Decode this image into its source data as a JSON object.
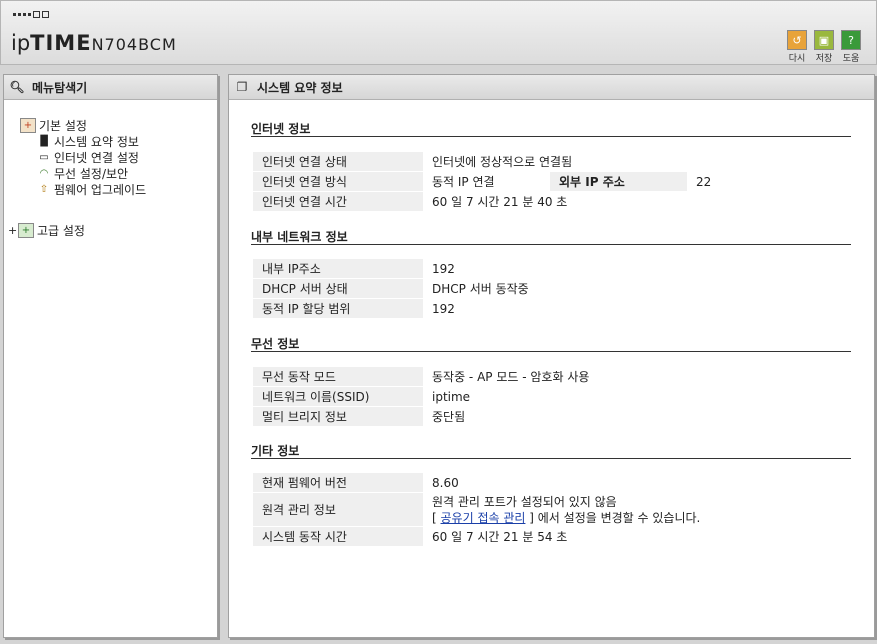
{
  "header": {
    "logo_ip": "ip",
    "logo_time": "TIME",
    "model": "N704BCM",
    "buttons": [
      {
        "label": "다시",
        "icon": "refresh-icon",
        "color": "#e8a33a"
      },
      {
        "label": "저장",
        "icon": "save-icon",
        "color": "#9ab83e"
      },
      {
        "label": "도움",
        "icon": "help-icon",
        "color": "#3a9a3a"
      }
    ]
  },
  "sidebar": {
    "title": "메뉴탐색기",
    "basic": "기본 설정",
    "items": [
      "시스템 요약 정보",
      "인터넷 연결 설정",
      "무선 설정/보안",
      "펌웨어 업그레이드"
    ],
    "advanced_expander": "+",
    "advanced": "고급 설정"
  },
  "main": {
    "title": "시스템 요약 정보",
    "internet": {
      "title": "인터넷 정보",
      "status_label": "인터넷 연결 상태",
      "status_value": "인터넷에 정상적으로 연결됨",
      "method_label": "인터넷 연결 방식",
      "method_value": "동적 IP 연결",
      "ext_ip_label": "외부 IP 주소",
      "ext_ip_value": "22",
      "time_label": "인터넷 연결 시간",
      "time_value": "60 일 7 시간 21 분 40 초"
    },
    "lan": {
      "title": "내부 네트워크 정보",
      "ip_label": "내부 IP주소",
      "ip_value": "192",
      "dhcp_label": "DHCP 서버 상태",
      "dhcp_value": "DHCP 서버 동작중",
      "range_label": "동적 IP 할당 범위",
      "range_value": "192"
    },
    "wireless": {
      "title": "무선 정보",
      "mode_label": "무선 동작 모드",
      "mode_value": "동작중 - AP 모드 - 암호화 사용",
      "ssid_label": "네트워크 이름(SSID)",
      "ssid_value": "iptime",
      "bridge_label": "멀티 브리지 정보",
      "bridge_value": "중단됨"
    },
    "etc": {
      "title": "기타 정보",
      "fw_label": "현재 펌웨어 버전",
      "fw_value": "8.60",
      "remote_label": "원격 관리 정보",
      "remote_line1": "원격 관리 포트가 설정되어 있지 않음",
      "remote_bracket_open": "[",
      "remote_link": "공유기 접속 관리",
      "remote_suffix": "] 에서 설정을 변경할 수 있습니다.",
      "uptime_label": "시스템 동작 시간",
      "uptime_value": "60 일 7 시간 21 분 54 초"
    }
  }
}
